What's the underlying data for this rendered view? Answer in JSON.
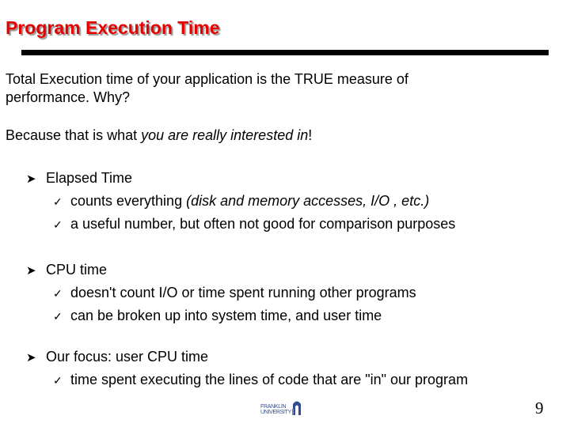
{
  "slide": {
    "title": "Program Execution Time",
    "intro": {
      "line1": "Total Execution time of your application is the TRUE measure of",
      "line2": "performance.  Why?"
    },
    "because": {
      "prefix": "Because that is what ",
      "emphasis": "you are really interested in",
      "suffix": "!"
    },
    "bullet_icon": "arrow-bullet-icon",
    "sub_bullet_icon": "checkmark-icon",
    "bullets": [
      {
        "label": "Elapsed Time",
        "subs": [
          {
            "text": "counts everything  ",
            "emphasis": "(disk and memory accesses, I/O , etc.)"
          },
          {
            "text": "a useful number, but often not good for comparison purposes"
          }
        ]
      },
      {
        "label": "CPU time",
        "subs": [
          {
            "text": "doesn't count I/O or time spent running other programs"
          },
          {
            "text": "can be broken up into system time, and user time"
          }
        ]
      },
      {
        "label": "Our focus:  user CPU time",
        "subs": [
          {
            "text": "time spent executing the lines of code that are \"in\" our program"
          }
        ]
      }
    ]
  },
  "footer": {
    "logo": {
      "line1": "FRANKLIN",
      "line2": "UNIVERSITY"
    },
    "page_number": "9"
  },
  "colors": {
    "title": "#e60000",
    "title_shadow": "#9a9a9a",
    "rule": "#000000",
    "logo": "#2f4d8f"
  }
}
